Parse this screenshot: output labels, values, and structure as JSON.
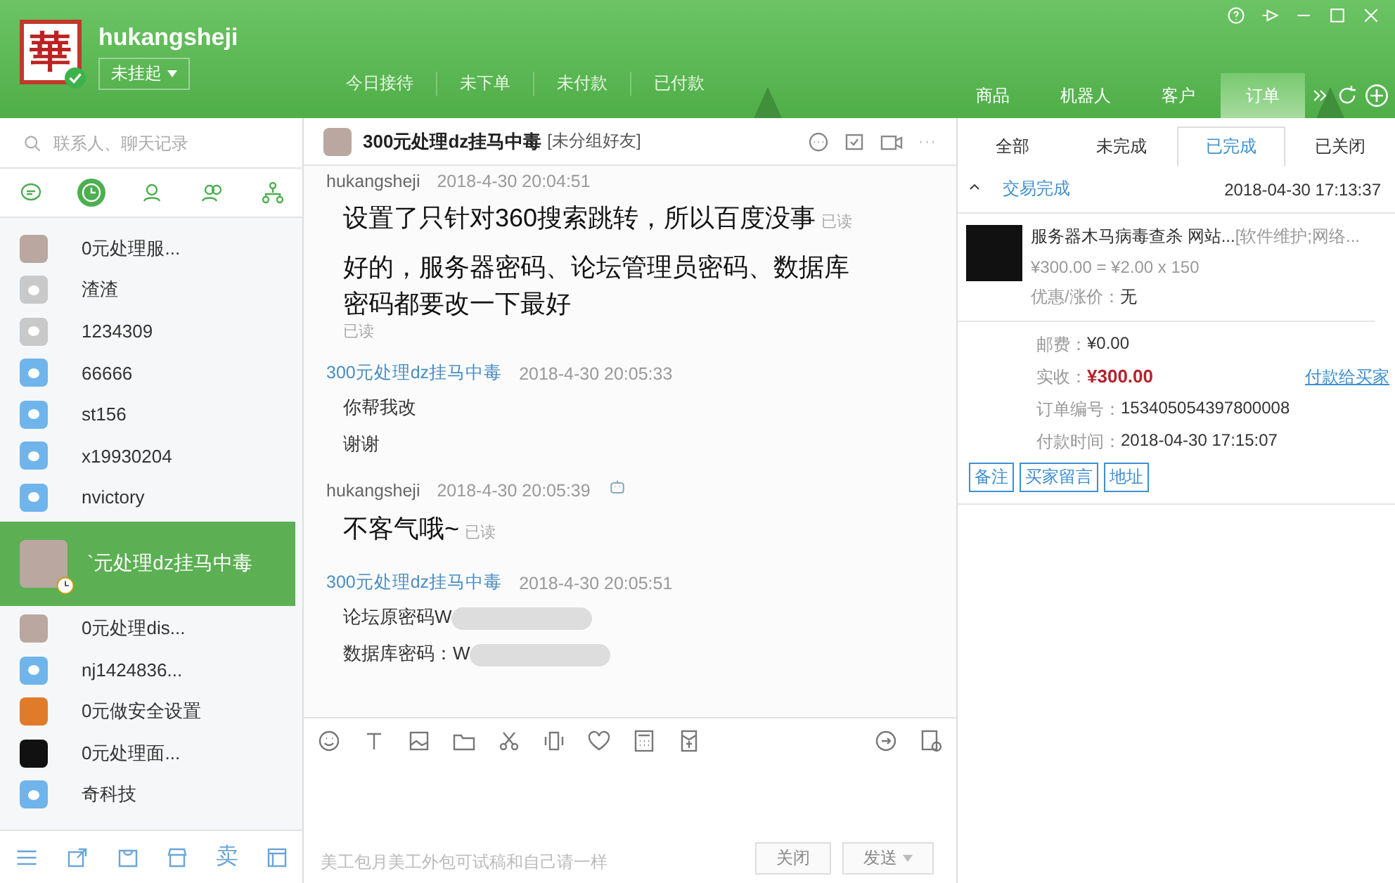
{
  "header": {
    "logo": "華",
    "username": "hukangsheji",
    "status": "未挂起",
    "stats": [
      "今日接待",
      "未下单",
      "未付款",
      "已付款"
    ],
    "nav": [
      {
        "label": "商品",
        "selected": false
      },
      {
        "label": "机器人",
        "selected": false
      },
      {
        "label": "客户",
        "selected": false
      },
      {
        "label": "订单",
        "selected": true
      }
    ]
  },
  "sidebar": {
    "search": {
      "placeholder": "联系人、聊天记录"
    },
    "tabs": [
      {
        "kind": "chat",
        "selected": false
      },
      {
        "kind": "recent",
        "selected": true
      },
      {
        "kind": "contact",
        "selected": false
      },
      {
        "kind": "group",
        "selected": false
      },
      {
        "kind": "org",
        "selected": false
      }
    ],
    "contacts": [
      {
        "name": "0元处理服...",
        "kind": "photo",
        "selected": false
      },
      {
        "name": "渣渣",
        "kind": "grey",
        "selected": false
      },
      {
        "name": "1234309",
        "kind": "grey",
        "selected": false
      },
      {
        "name": "66666",
        "kind": "blue",
        "selected": false
      },
      {
        "name": "st156",
        "kind": "blue",
        "selected": false
      },
      {
        "name": "x19930204",
        "kind": "blue",
        "selected": false
      },
      {
        "name": "nvictory",
        "kind": "blue",
        "selected": false
      },
      {
        "name": "`元处理dz挂马中毒",
        "kind": "photo",
        "selected": true
      },
      {
        "name": "0元处理dis...",
        "kind": "photo",
        "selected": false
      },
      {
        "name": "nj1424836...",
        "kind": "blue",
        "selected": false
      },
      {
        "name": "0元做安全设置",
        "kind": "orange",
        "selected": false
      },
      {
        "name": "0元处理面...",
        "kind": "dark",
        "selected": false
      },
      {
        "name": "奇科技",
        "kind": "blue",
        "selected": false
      }
    ],
    "bottom_bar": {
      "sell_label": "卖"
    }
  },
  "chat": {
    "title": "300元处理dz挂马中毒",
    "group": "[未分组好友]",
    "messages": [
      {
        "sender": "hukangsheji",
        "time": "2018-4-30 20:04:51",
        "kind": "self",
        "bubbles": [
          {
            "text": "设置了只针对360搜索跳转，所以百度没事",
            "status": "已读"
          },
          {
            "text": "好的，服务器密码、论坛管理员密码、数据库密码都要改一下最好",
            "status": "已读",
            "status_below": true
          }
        ]
      },
      {
        "sender": "300元处理dz挂马中毒",
        "time": "2018-4-30 20:05:33",
        "kind": "other",
        "bubbles": [
          {
            "text": "你帮我改"
          },
          {
            "text": "谢谢"
          }
        ]
      },
      {
        "sender": "hukangsheji",
        "time": "2018-4-30 20:05:39",
        "kind": "self",
        "robot": true,
        "bubbles": [
          {
            "text": "不客气哦~",
            "status": "已读"
          }
        ]
      },
      {
        "sender": "300元处理dz挂马中毒",
        "time": "2018-4-30 20:05:51",
        "kind": "other",
        "bubbles": [
          {
            "text": "论坛原密码W",
            "redacted": true
          },
          {
            "text": "数据库密码：W",
            "redacted": true
          }
        ]
      }
    ],
    "quick_phrase": "美工包月美工外包可试稿和自己请一样",
    "buttons": [
      "关闭",
      "发送"
    ]
  },
  "orders": {
    "tabs": [
      {
        "label": "全部",
        "selected": false
      },
      {
        "label": "未完成",
        "selected": false
      },
      {
        "label": "已完成",
        "selected": true
      },
      {
        "label": "已关闭",
        "selected": false
      }
    ],
    "status": "交易完成",
    "expanded": true,
    "time": "2018-04-30 17:13:37",
    "product": {
      "title": "服务器木马病毒查杀 网站...",
      "tags": "[软件维护;网络...",
      "price": "¥300.00 = ¥2.00 x 150",
      "discount_label": "优惠/涨价：",
      "discount": "无"
    },
    "fields": [
      {
        "label": "邮费：",
        "value": "¥0.00",
        "kind": "plain"
      },
      {
        "label": "实收：",
        "value": "¥300.00",
        "kind": "total",
        "link": "付款给买家"
      },
      {
        "label": "订单编号：",
        "value": "153405054397800008",
        "kind": "plain"
      },
      {
        "label": "付款时间：",
        "value": "2018-04-30 17:15:07",
        "kind": "plain"
      }
    ],
    "actions": [
      "备注",
      "买家留言",
      "地址"
    ]
  }
}
